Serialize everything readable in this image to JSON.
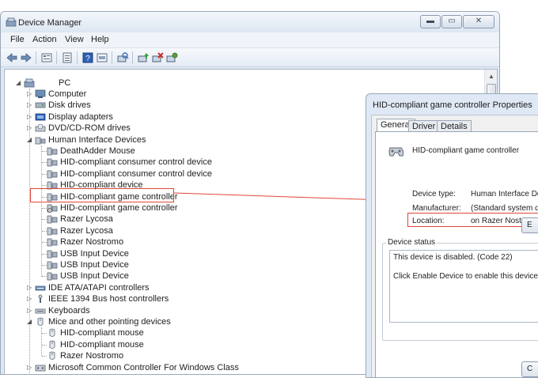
{
  "device_manager": {
    "title": "Device Manager",
    "menu": [
      "File",
      "Action",
      "View",
      "Help"
    ],
    "window_buttons": [
      "minimize",
      "maximize",
      "close"
    ],
    "toolbar_icons": [
      "back-arrow-icon",
      "forward-arrow-icon",
      "properties-view-icon",
      "list-view-icon",
      "help-icon",
      "resources-view-icon",
      "scan-hardware-icon",
      "update-driver-icon",
      "uninstall-icon",
      "enable-device-icon"
    ],
    "tree": {
      "root": "PC",
      "items": [
        {
          "label": "Computer",
          "level": 1,
          "icon": "computer-icon",
          "expander": "collapsed"
        },
        {
          "label": "Disk drives",
          "level": 1,
          "icon": "disk-drive-icon",
          "expander": "collapsed"
        },
        {
          "label": "Display adapters",
          "level": 1,
          "icon": "display-adapter-icon",
          "expander": "collapsed"
        },
        {
          "label": "DVD/CD-ROM drives",
          "level": 1,
          "icon": "dvd-drive-icon",
          "expander": "collapsed"
        },
        {
          "label": "Human Interface Devices",
          "level": 1,
          "icon": "hid-icon",
          "expander": "expanded"
        },
        {
          "label": "DeathAdder Mouse",
          "level": 2,
          "icon": "hid-device-icon"
        },
        {
          "label": "HID-compliant consumer control device",
          "level": 2,
          "icon": "hid-device-icon"
        },
        {
          "label": "HID-compliant consumer control device",
          "level": 2,
          "icon": "hid-device-icon"
        },
        {
          "label": "HID-compliant device",
          "level": 2,
          "icon": "hid-device-icon"
        },
        {
          "label": "HID-compliant game controller",
          "level": 2,
          "icon": "hid-device-icon"
        },
        {
          "label": "HID-compliant game controller",
          "level": 2,
          "icon": "hid-device-disabled-icon",
          "highlighted": true
        },
        {
          "label": "Razer Lycosa",
          "level": 2,
          "icon": "hid-device-icon"
        },
        {
          "label": "Razer Lycosa",
          "level": 2,
          "icon": "hid-device-icon"
        },
        {
          "label": "Razer Nostromo",
          "level": 2,
          "icon": "hid-device-icon"
        },
        {
          "label": "USB Input Device",
          "level": 2,
          "icon": "hid-device-icon"
        },
        {
          "label": "USB Input Device",
          "level": 2,
          "icon": "hid-device-icon"
        },
        {
          "label": "USB Input Device",
          "level": 2,
          "icon": "hid-device-icon"
        },
        {
          "label": "IDE ATA/ATAPI controllers",
          "level": 1,
          "icon": "ide-controller-icon",
          "expander": "collapsed"
        },
        {
          "label": "IEEE 1394 Bus host controllers",
          "level": 1,
          "icon": "firewire-icon",
          "expander": "collapsed"
        },
        {
          "label": "Keyboards",
          "level": 1,
          "icon": "keyboard-icon",
          "expander": "collapsed"
        },
        {
          "label": "Mice and other pointing devices",
          "level": 1,
          "icon": "mouse-icon",
          "expander": "expanded"
        },
        {
          "label": "HID-compliant mouse",
          "level": 2,
          "icon": "mouse-icon"
        },
        {
          "label": "HID-compliant mouse",
          "level": 2,
          "icon": "mouse-icon"
        },
        {
          "label": "Razer Nostromo",
          "level": 2,
          "icon": "mouse-icon"
        },
        {
          "label": "Microsoft Common Controller For Windows Class",
          "level": 1,
          "icon": "controller-class-icon",
          "expander": "collapsed"
        }
      ]
    }
  },
  "properties_dialog": {
    "title": "HID-compliant game controller Properties",
    "tabs": [
      "General",
      "Driver",
      "Details"
    ],
    "active_tab": "General",
    "device_name": "HID-compliant game controller",
    "fields": [
      {
        "label": "Device type:",
        "value": "Human Interface Devic"
      },
      {
        "label": "Manufacturer:",
        "value": "(Standard system devic"
      },
      {
        "label": "Location:",
        "value": "on Razer Nostromo"
      }
    ],
    "device_status_legend": "Device status",
    "status_lines": [
      "This device is disabled. (Code 22)",
      "Click Enable Device to enable this device."
    ],
    "enable_button_partial": "E",
    "ok_button_partial": "C"
  },
  "colors": {
    "highlight": "#e0473a",
    "window_frame": "#dfe9f5"
  }
}
